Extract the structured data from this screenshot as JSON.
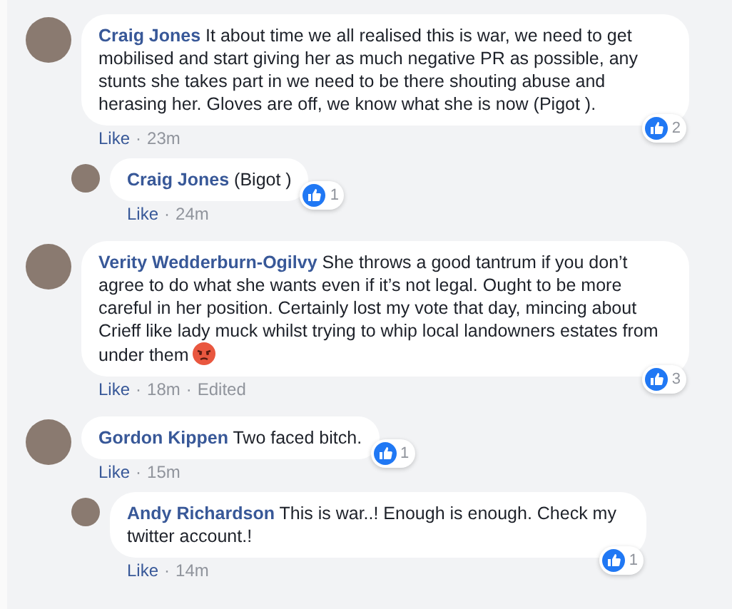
{
  "meta_separator": "·",
  "comments": [
    {
      "author": "Craig Jones",
      "text": "It about time we all realised this is war, we need to get mobilised and start giving her as much negative PR as possible, any stunts she takes part in we need to be there shouting abuse and herasing her. Gloves are off, we know what she is now (Pigot ).",
      "reactions": "2",
      "like": "Like",
      "time": "23m",
      "replies": [
        {
          "author": "Craig Jones",
          "text": "(Bigot )",
          "reactions": "1",
          "like": "Like",
          "time": "24m"
        }
      ]
    },
    {
      "author": "Verity Wedderburn-Ogilvy",
      "text": "She throws a good tantrum if you don’t agree to do what she wants even if it’s not legal. Ought to be more careful in her position. Certainly lost my vote that day, mincing about Crieff like lady muck whilst trying to whip local landowners estates from under them",
      "kind": "emoji-end",
      "reactions": "3",
      "like": "Like",
      "time": "18m",
      "edited": "Edited"
    },
    {
      "author": "Gordon Kippen",
      "text": "Two faced bitch.",
      "reactions": "1",
      "like": "Like",
      "time": "15m",
      "replies": [
        {
          "author": "Andy Richardson",
          "text": "This is war..! Enough is enough. Check my twitter account.!",
          "reactions": "1",
          "like": "Like",
          "time": "14m"
        }
      ]
    }
  ]
}
